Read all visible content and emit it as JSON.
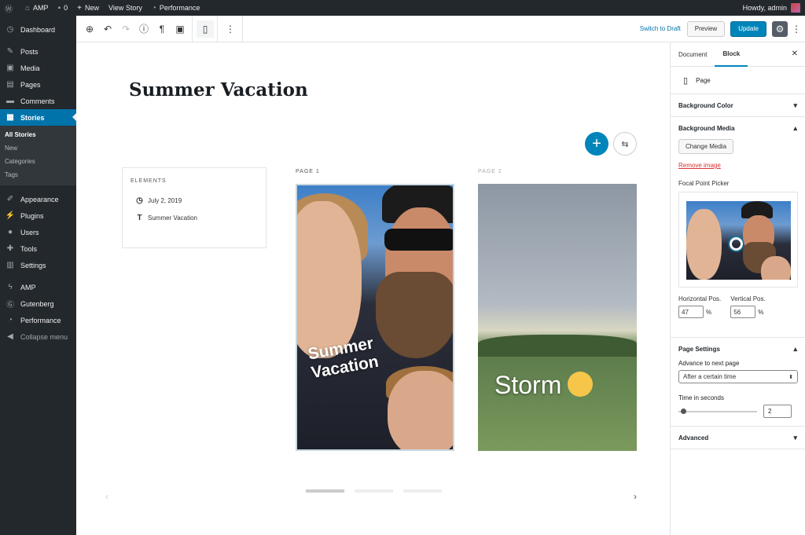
{
  "admin_bar": {
    "site_name": "AMP",
    "comments_count": "0",
    "new_label": "New",
    "view_story_label": "View Story",
    "performance_label": "Performance",
    "howdy_text": "Howdy, admin"
  },
  "sidebar": {
    "items": [
      {
        "label": "Dashboard",
        "icon": "dashboard-icon"
      },
      {
        "label": "Posts",
        "icon": "pin-icon"
      },
      {
        "label": "Media",
        "icon": "media-icon"
      },
      {
        "label": "Pages",
        "icon": "pages-icon"
      },
      {
        "label": "Comments",
        "icon": "comment-icon"
      },
      {
        "label": "Stories",
        "icon": "stories-icon"
      },
      {
        "label": "Appearance",
        "icon": "brush-icon"
      },
      {
        "label": "Plugins",
        "icon": "plug-icon"
      },
      {
        "label": "Users",
        "icon": "users-icon"
      },
      {
        "label": "Tools",
        "icon": "wrench-icon"
      },
      {
        "label": "Settings",
        "icon": "sliders-icon"
      },
      {
        "label": "AMP",
        "icon": "amp-icon"
      },
      {
        "label": "Gutenberg",
        "icon": "gutenberg-icon"
      },
      {
        "label": "Performance",
        "icon": "gauge-icon"
      }
    ],
    "stories_sub": [
      "All Stories",
      "New",
      "Categories",
      "Tags"
    ],
    "collapse_label": "Collapse menu"
  },
  "toolbar": {
    "switch_to_draft": "Switch to Draft",
    "preview": "Preview",
    "update": "Update"
  },
  "editor": {
    "title": "Summer Vacation",
    "elements_heading": "ELEMENTS",
    "elements": [
      {
        "icon": "clock-icon",
        "label": "July 2, 2019"
      },
      {
        "icon": "text-icon",
        "label": "Summer Vacation"
      }
    ],
    "page1_label": "PAGE 1",
    "page2_label": "PAGE 2",
    "page1_text_line1": "Summer",
    "page1_text_line2": "Vacation",
    "page2_text": "Storm",
    "page2_emoji": "scream-emoji-icon"
  },
  "inspector": {
    "tab_document": "Document",
    "tab_block": "Block",
    "block_name": "Page",
    "background_color": "Background Color",
    "background_media": "Background Media",
    "change_media": "Change Media",
    "remove_image": "Remove image",
    "focal_point_picker": "Focal Point Picker",
    "horizontal_pos_label": "Horizontal Pos.",
    "vertical_pos_label": "Vertical Pos.",
    "horizontal_pos": "47",
    "vertical_pos": "56",
    "percent": "%",
    "page_settings": "Page Settings",
    "advance_label": "Advance to next page",
    "advance_value": "After a certain time",
    "time_label": "Time in seconds",
    "time_value": "2",
    "advanced": "Advanced"
  },
  "colors": {
    "admin_dark": "#23282d",
    "accent_blue": "#0073aa",
    "primary_button": "#0085ba",
    "danger_red": "#dc3232"
  }
}
